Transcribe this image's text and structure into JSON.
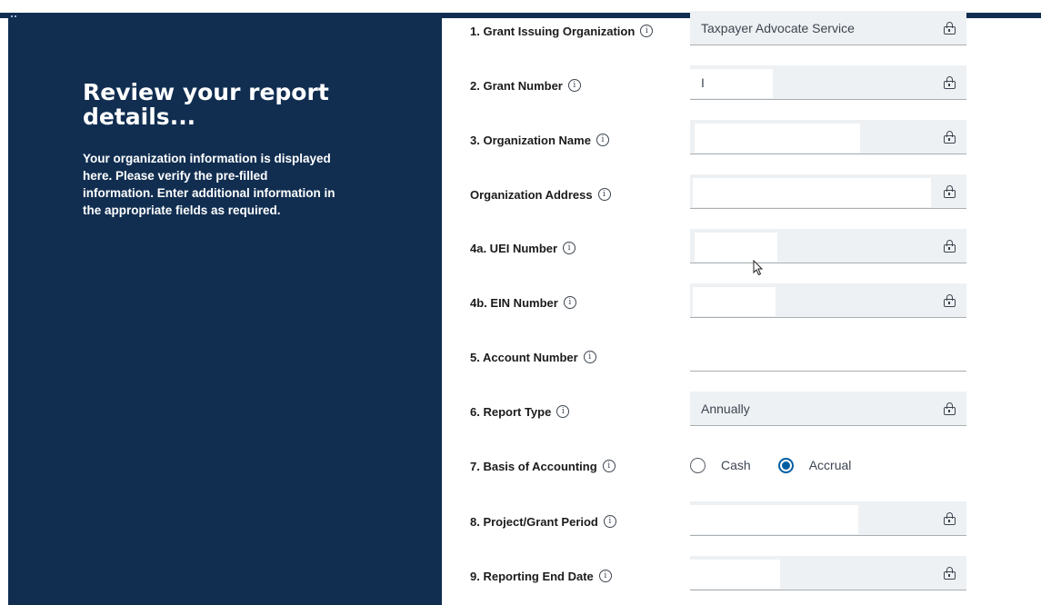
{
  "sidebar": {
    "heading": "Review your report details...",
    "description": "Your organization information is displayed here. Please verify the pre-filled information. Enter additional information in the appropriate fields as required."
  },
  "form": {
    "fields": [
      {
        "label": "1. Grant Issuing Organization",
        "value": "Taxpayer Advocate Service",
        "locked": true
      },
      {
        "label": "2. Grant Number",
        "value": "I",
        "locked": true
      },
      {
        "label": "3. Organization Name",
        "value": "",
        "locked": true
      },
      {
        "label": "Organization Address",
        "value": "",
        "locked": true
      },
      {
        "label": "4a. UEI Number",
        "value": "",
        "locked": true
      },
      {
        "label": "4b. EIN Number",
        "value": "",
        "locked": true
      },
      {
        "label": "5. Account Number",
        "value": "",
        "locked": false
      },
      {
        "label": "6. Report Type",
        "value": "Annually",
        "locked": true
      },
      {
        "label": "7. Basis of Accounting",
        "options": [
          "Cash",
          "Accrual"
        ],
        "selected": "Accrual"
      },
      {
        "label": "8. Project/Grant Period",
        "value": "",
        "locked": true
      },
      {
        "label": "9. Reporting End Date",
        "value": "",
        "locked": true
      }
    ]
  },
  "icons": {
    "info": "info-circle-icon",
    "lock": "lock-icon",
    "cursor": "mouse-pointer-icon"
  },
  "colors": {
    "navy": "#112e51",
    "field_bg": "#eef1f3",
    "radio_selected": "#005ea2"
  }
}
